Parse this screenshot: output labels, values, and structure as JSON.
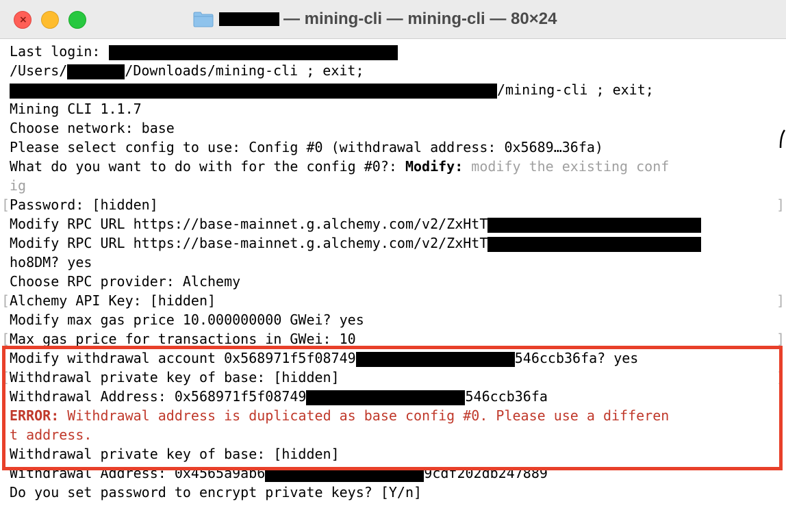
{
  "window": {
    "title": "— mining-cli — mining-cli — 80×24"
  },
  "icons": {
    "folder": "folder-icon",
    "close": "close-icon",
    "minimize": "minimize-icon",
    "maximize": "maximize-icon"
  },
  "colors": {
    "error_text": "#c0392b",
    "highlight_border": "#e8402a",
    "hint_text": "#a0a0a0"
  },
  "terminal": {
    "l1": "Last login: ",
    "l2a": "/Users/",
    "l2b": "/Downloads/mining-cli ; exit;",
    "l3": "/mining-cli ; exit;",
    "l4": "Mining CLI 1.1.7",
    "l5": "Choose network: base",
    "l6": "Please select config to use: Config #0 (withdrawal address: 0x5689…36fa)",
    "l7a": "What do you want to do with for the config #0?: ",
    "l7b": "Modify:",
    "l7c": " modify the existing conf",
    "l8": "ig",
    "l9": "Password: [hidden]",
    "l10": "Modify RPC URL https://base-mainnet.g.alchemy.com/v2/ZxHtT",
    "l11": "Modify RPC URL https://base-mainnet.g.alchemy.com/v2/ZxHtT",
    "l12": "ho8DM? yes",
    "l13": "Choose RPC provider: Alchemy",
    "l14": "Alchemy API Key: [hidden]",
    "l15": "Modify max gas price 10.000000000 GWei? yes",
    "l16": "Max gas price for transactions in GWei: 10",
    "l17a": "Modify withdrawal account 0x568971f5f08749",
    "l17b": "546ccb36fa? yes",
    "l18": "Withdrawal private key of base: [hidden]",
    "l19a": "Withdrawal Address: 0x568971f5f08749",
    "l19b": "546ccb36fa",
    "l20a": "ERROR:",
    "l20b": " Withdrawal address is duplicated as base config #0. Please use a differen",
    "l21": "t address.",
    "l22": "Withdrawal private key of base: [hidden]",
    "l23a": "Withdrawal Address: 0x4565a9ab6",
    "l23b": "9cdf202db247889",
    "l24": "Do you set password to encrypt private keys? [Y/n]"
  },
  "bracket_left": "[",
  "bracket_right": "]"
}
